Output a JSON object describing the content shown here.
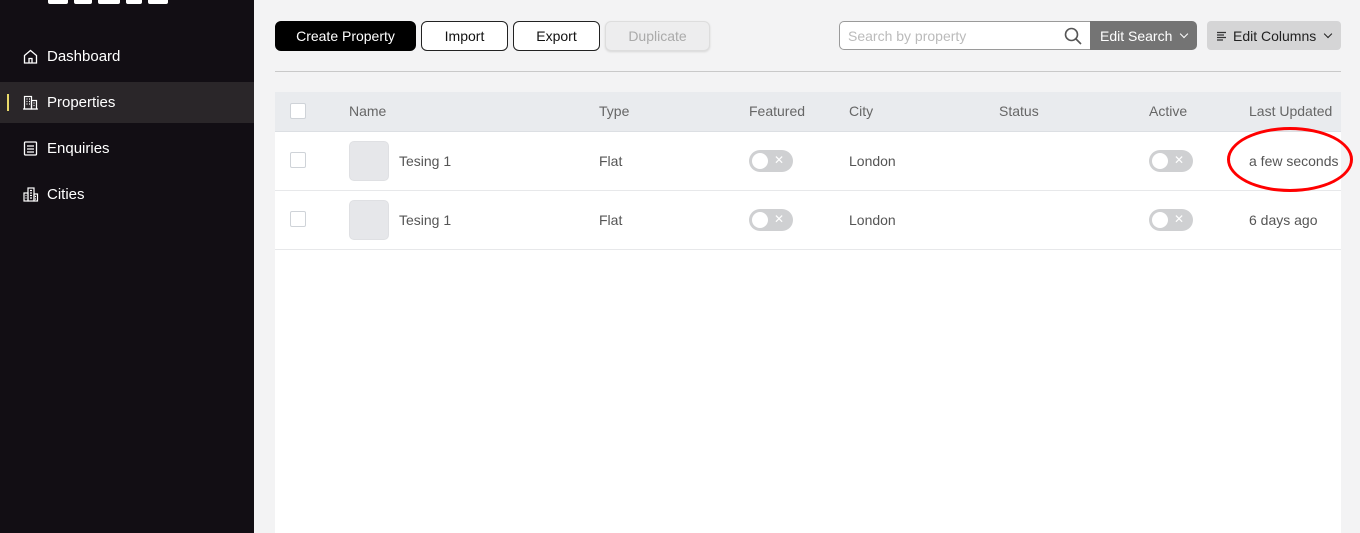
{
  "sidebar": {
    "items": [
      {
        "label": "Dashboard",
        "icon": "home-icon"
      },
      {
        "label": "Properties",
        "icon": "building-icon",
        "active": true
      },
      {
        "label": "Enquiries",
        "icon": "document-list-icon"
      },
      {
        "label": "Cities",
        "icon": "city-icon"
      }
    ]
  },
  "toolbar": {
    "create_label": "Create Property",
    "import_label": "Import",
    "export_label": "Export",
    "duplicate_label": "Duplicate",
    "search_placeholder": "Search by property",
    "edit_search_label": "Edit Search",
    "edit_columns_label": "Edit Columns"
  },
  "table": {
    "headers": [
      "Name",
      "Type",
      "Featured",
      "City",
      "Status",
      "Active",
      "Last Updated"
    ],
    "rows": [
      {
        "name": "Tesing 1",
        "type": "Flat",
        "featured": false,
        "city": "London",
        "status": "",
        "active": false,
        "last_updated": "a few seconds"
      },
      {
        "name": "Tesing 1",
        "type": "Flat",
        "featured": false,
        "city": "London",
        "status": "",
        "active": false,
        "last_updated": "6 days ago"
      }
    ],
    "toggle_off_glyph": "✕"
  },
  "colors": {
    "sidebar_bg": "#120e14",
    "active_accent": "#e9d96a",
    "annotation": "#ff0000"
  }
}
